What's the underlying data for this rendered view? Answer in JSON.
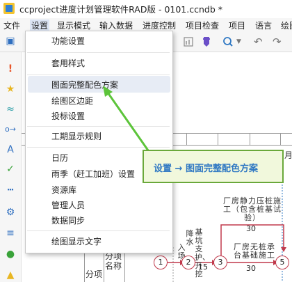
{
  "window": {
    "title": "ccproject进度计划管理软件RAD版 - 0101.ccndb *"
  },
  "menubar": {
    "items": [
      "文件",
      "设置",
      "显示模式",
      "输入数据",
      "进度控制",
      "项目检查",
      "项目",
      "语言",
      "绘图"
    ]
  },
  "settings_menu": {
    "items": [
      "功能设置",
      "套用样式",
      "图面完整配色方案",
      "绘图区边距",
      "投标设置",
      "工期显示规则",
      "日历",
      "雨季（赶工加班）设置",
      "资源库",
      "管理人员",
      "数据同步",
      "绘图显示文字"
    ],
    "highlighted": "图面完整配色方案"
  },
  "callout": {
    "text": "设置 → 图面完整配色方案"
  },
  "canvas": {
    "column_header": "分项名称",
    "group_label": "分项",
    "tasks": [
      {
        "label": "厂房静力压桩施工（包含桩基试验）",
        "duration": "30"
      },
      {
        "label": "厂房无桩承台基础施工",
        "duration": "30"
      },
      {
        "label": "基坑支护、开挖",
        "duration": "15"
      }
    ],
    "nodes": [
      "1",
      "2",
      "3",
      "5"
    ],
    "partial_labels": [
      "入场",
      "降水"
    ],
    "header_fragment": "月"
  },
  "colors": {
    "network_line": "#c0394b",
    "callout_border": "#6aa83a",
    "callout_text": "#2f78c3",
    "arrow": "#5cc43a"
  },
  "icons": {
    "toolbar": [
      "chart-icon",
      "bookmark-icon",
      "search-icon",
      "undo-icon",
      "redo-icon"
    ],
    "sidebar": [
      "calendar-icon",
      "exclamation-icon",
      "star-icon",
      "wave-icon",
      "link-icon",
      "text-icon",
      "check-icon",
      "dashes-icon",
      "gear-icon",
      "sort-icon",
      "users-icon",
      "warning-icon"
    ]
  }
}
